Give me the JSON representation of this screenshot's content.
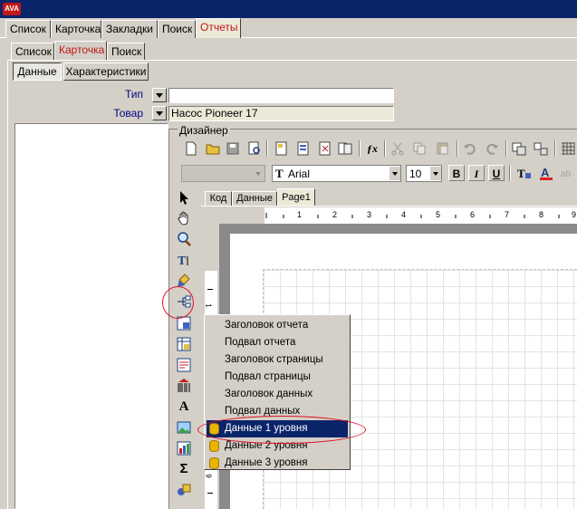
{
  "main_tabs": [
    "Список",
    "Карточка",
    "Закладки",
    "Поиск",
    "Отчеты"
  ],
  "sub_tabs": [
    "Список",
    "Карточка",
    "Поиск"
  ],
  "mode_buttons": [
    "Данные",
    "Характеристики"
  ],
  "fields": {
    "type_label": "Тип",
    "type_value": "",
    "product_label": "Товар",
    "product_value": "Насос Pioneer 17"
  },
  "designer": {
    "title": "Дизайнер",
    "font_name": "Arial",
    "font_size": "10",
    "style_buttons": [
      "B",
      "I",
      "U"
    ],
    "tabs": [
      "Код",
      "Данные",
      "Page1"
    ],
    "ruler_marks": [
      "1",
      "2",
      "3",
      "4",
      "5",
      "6",
      "7",
      "8",
      "9"
    ],
    "vruler_marks": [
      "1",
      "9"
    ]
  },
  "context_menu": {
    "items": [
      "Заголовок отчета",
      "Подвал отчета",
      "Заголовок страницы",
      "Подвал страницы",
      "Заголовок данных",
      "Подвал данных",
      "Данные 1 уровня",
      "Данные 2 уровня",
      "Данные 3 уровня"
    ],
    "selected_index": 6
  },
  "colors": {
    "active_tab": "#c01818",
    "menu_selection": "#0a246a",
    "highlight_ellipse": "#e01020"
  }
}
